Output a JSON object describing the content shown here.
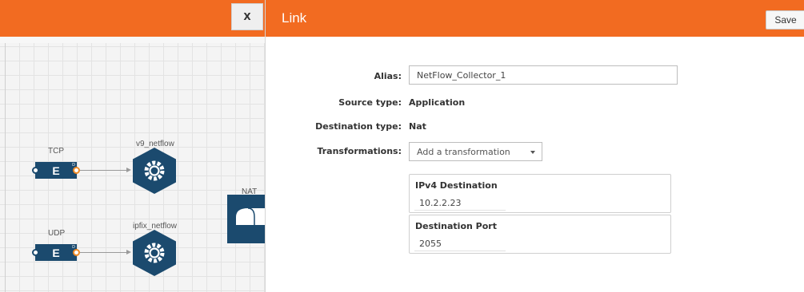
{
  "canvas": {
    "close_label": "X",
    "nodes": {
      "tcp_label": "TCP",
      "udp_label": "UDP",
      "v9_label": "v9_netflow",
      "ipfix_label": "ipfix_netflow",
      "nat_label": "NAT",
      "connector_glyph": "E",
      "connector_port_letter": "D"
    }
  },
  "panel": {
    "title": "Link",
    "save_label": "Save",
    "alias_label": "Alias:",
    "alias_value": "NetFlow_Collector_1",
    "source_type_label": "Source type:",
    "source_type_value": "Application",
    "destination_type_label": "Destination type:",
    "destination_type_value": "Nat",
    "transformations_label": "Transformations:",
    "transformations_placeholder": "Add a transformation",
    "transformations": [
      {
        "title": "IPv4 Destination",
        "value": "10.2.2.23"
      },
      {
        "title": "Destination Port",
        "value": "2055"
      }
    ]
  },
  "colors": {
    "accent_orange": "#f26b21",
    "node_navy": "#1b4a6e",
    "port_orange": "#f08a24"
  }
}
